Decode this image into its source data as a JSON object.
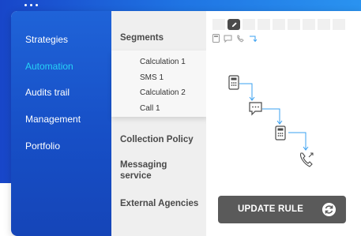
{
  "window": {
    "controls": [
      "dot",
      "dot",
      "dot"
    ]
  },
  "nav": {
    "items": [
      {
        "label": "Strategies",
        "active": false
      },
      {
        "label": "Automation",
        "active": true
      },
      {
        "label": "Audits trail",
        "active": false
      },
      {
        "label": "Management",
        "active": false
      },
      {
        "label": "Portfolio",
        "active": false
      }
    ]
  },
  "segments": {
    "heading": "Segments",
    "submenu": [
      "Calculation 1",
      "SMS 1",
      "Calculation 2",
      "Call 1"
    ],
    "sections": [
      "Collection Policy",
      "Messaging service",
      "External Agencies"
    ]
  },
  "canvas": {
    "toolbar_icons": [
      "edit-icon"
    ],
    "mini_icons": [
      "calculator-icon",
      "chat-icon",
      "phone-icon",
      "arrow-icon"
    ],
    "flow": [
      "calculator-icon",
      "chat-icon",
      "calculator-icon",
      "phone-out-icon"
    ],
    "update_button": {
      "label": "UPDATE RULE",
      "icon": "refresh-icon"
    }
  },
  "colors": {
    "nav_bg": "#1f63d8",
    "nav_active": "#27d2f6",
    "button_bg": "#5a5a5a",
    "connector": "#3aa0f0"
  }
}
